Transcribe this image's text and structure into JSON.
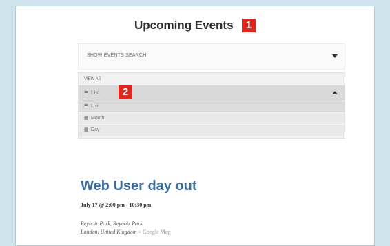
{
  "heading": "Upcoming Events",
  "callouts": [
    "1",
    "2"
  ],
  "search": {
    "label": "SHOW EVENTS SEARCH"
  },
  "view_as": {
    "label": "VIEW AS",
    "selected": "List",
    "options": [
      {
        "icon": "list-icon",
        "label": "List"
      },
      {
        "icon": "calendar-icon",
        "label": "Month"
      },
      {
        "icon": "calendar-day-icon",
        "label": "Day"
      }
    ]
  },
  "event": {
    "title": "Web User day out",
    "time": "July 17 @ 2:00 pm - 10:30 pm",
    "venue_line1": "Reynoir Park, Reynoir Park",
    "venue_line2": "London, United Kingdom",
    "map_link": "+ Google Map"
  },
  "colors": {
    "accent": "#3a6ea5",
    "callout": "#e0261f",
    "background": "#cfe3ec"
  }
}
